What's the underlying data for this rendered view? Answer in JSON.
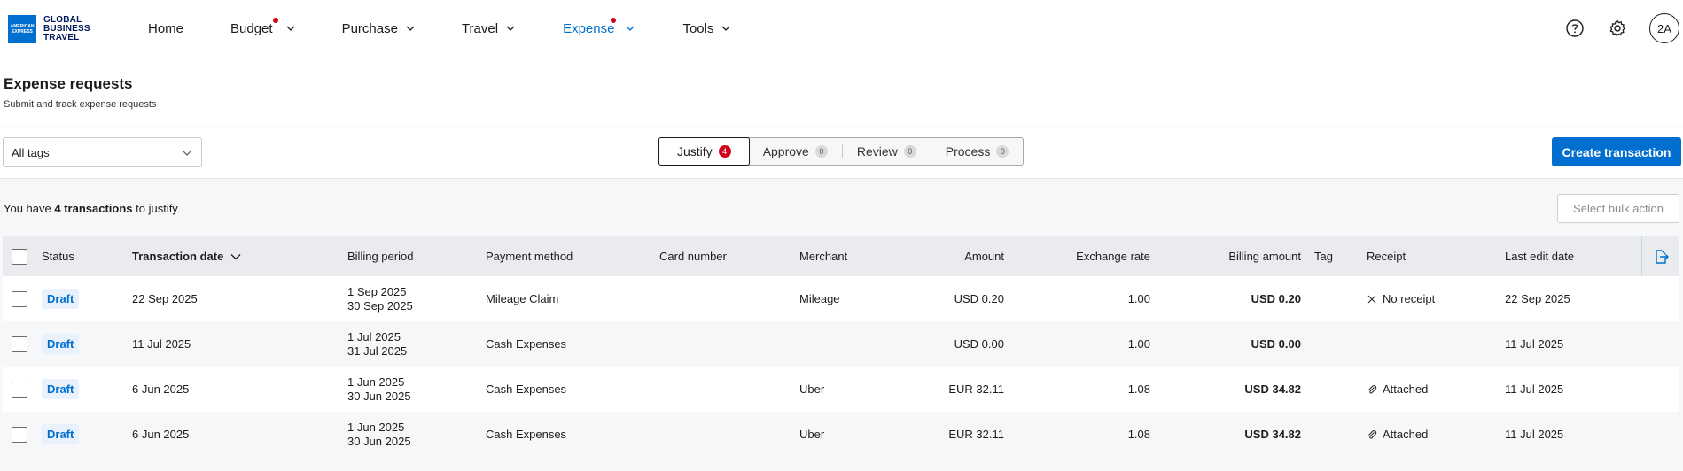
{
  "brand": {
    "logo_box": "AMERICAN EXPRESS",
    "logo_text": [
      "GLOBAL",
      "BUSINESS",
      "TRAVEL"
    ],
    "accent": "#006fcf"
  },
  "nav": {
    "items": [
      {
        "label": "Home",
        "dropdown": false,
        "dot": false,
        "active": false
      },
      {
        "label": "Budget",
        "dropdown": true,
        "dot": true,
        "active": false
      },
      {
        "label": "Purchase",
        "dropdown": true,
        "dot": false,
        "active": false
      },
      {
        "label": "Travel",
        "dropdown": true,
        "dot": false,
        "active": false
      },
      {
        "label": "Expense",
        "dropdown": true,
        "dot": true,
        "active": true
      },
      {
        "label": "Tools",
        "dropdown": true,
        "dot": false,
        "active": false
      }
    ],
    "avatar_initials": "2A",
    "icons": [
      "help-icon",
      "settings-icon"
    ]
  },
  "header": {
    "title": "Expense requests",
    "subtitle": "Submit and track expense requests"
  },
  "toolbar": {
    "tags_value": "All tags",
    "tabs": [
      {
        "label": "Justify",
        "count": "4",
        "active": true
      },
      {
        "label": "Approve",
        "count": "0",
        "active": false
      },
      {
        "label": "Review",
        "count": "0",
        "active": false
      },
      {
        "label": "Process",
        "count": "0",
        "active": false
      }
    ],
    "create_label": "Create transaction"
  },
  "summary": {
    "prefix": "You have ",
    "count_text": "4 transactions",
    "suffix": " to justify",
    "bulk_label": "Select bulk action"
  },
  "table": {
    "headers": {
      "status": "Status",
      "transaction_date": "Transaction date",
      "billing_period": "Billing period",
      "payment_method": "Payment method",
      "card_number": "Card number",
      "merchant": "Merchant",
      "amount": "Amount",
      "exchange_rate": "Exchange rate",
      "billing_amount": "Billing amount",
      "tag": "Tag",
      "receipt": "Receipt",
      "last_edit_date": "Last edit date"
    },
    "rows": [
      {
        "status": "Draft",
        "transaction_date": "22 Sep 2025",
        "billing_start": "1 Sep 2025",
        "billing_end": "30 Sep 2025",
        "payment_method": "Mileage Claim",
        "card_number": "",
        "merchant": "Mileage",
        "amount": "USD 0.20",
        "exchange_rate": "1.00",
        "billing_amount": "USD 0.20",
        "tag": "",
        "receipt": "No receipt",
        "receipt_icon": "close-icon",
        "last_edit_date": "22 Sep 2025"
      },
      {
        "status": "Draft",
        "transaction_date": "11 Jul 2025",
        "billing_start": "1 Jul 2025",
        "billing_end": "31 Jul 2025",
        "payment_method": "Cash Expenses",
        "card_number": "",
        "merchant": "",
        "amount": "USD 0.00",
        "exchange_rate": "1.00",
        "billing_amount": "USD 0.00",
        "tag": "",
        "receipt": "",
        "receipt_icon": "",
        "last_edit_date": "11 Jul 2025"
      },
      {
        "status": "Draft",
        "transaction_date": "6 Jun 2025",
        "billing_start": "1 Jun 2025",
        "billing_end": "30 Jun 2025",
        "payment_method": "Cash Expenses",
        "card_number": "",
        "merchant": "Uber",
        "amount": "EUR 32.11",
        "exchange_rate": "1.08",
        "billing_amount": "USD 34.82",
        "tag": "",
        "receipt": "Attached",
        "receipt_icon": "paperclip-icon",
        "last_edit_date": "11 Jul 2025"
      },
      {
        "status": "Draft",
        "transaction_date": "6 Jun 2025",
        "billing_start": "1 Jun 2025",
        "billing_end": "30 Jun 2025",
        "payment_method": "Cash Expenses",
        "card_number": "",
        "merchant": "Uber",
        "amount": "EUR 32.11",
        "exchange_rate": "1.08",
        "billing_amount": "USD 34.82",
        "tag": "",
        "receipt": "Attached",
        "receipt_icon": "paperclip-icon",
        "last_edit_date": "11 Jul 2025"
      }
    ]
  }
}
